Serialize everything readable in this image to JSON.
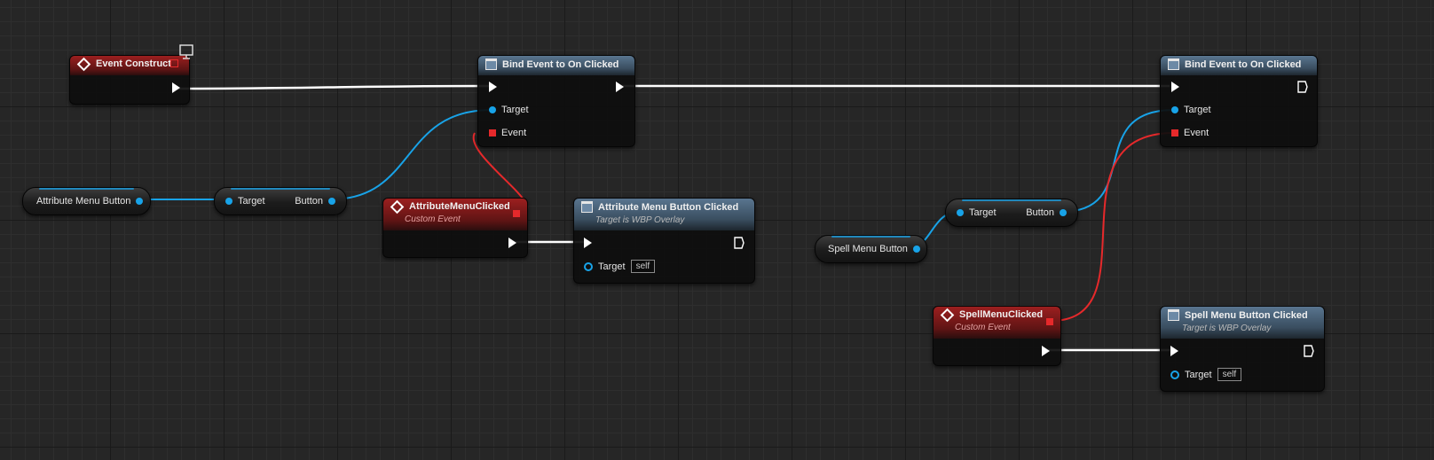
{
  "nodes": {
    "event_construct": {
      "title": "Event Construct"
    },
    "bind1": {
      "title": "Bind Event to On Clicked",
      "target": "Target",
      "event": "Event"
    },
    "bind2": {
      "title": "Bind Event to On Clicked",
      "target": "Target",
      "event": "Event"
    },
    "attr_var": {
      "label": "Attribute Menu Button"
    },
    "attr_get": {
      "target": "Target",
      "button": "Button"
    },
    "attr_event": {
      "title": "AttributeMenuClicked",
      "subtitle": "Custom Event"
    },
    "attr_call": {
      "title": "Attribute Menu Button Clicked",
      "subtitle": "Target is WBP Overlay",
      "target": "Target",
      "self": "self"
    },
    "spell_var": {
      "label": "Spell Menu Button"
    },
    "spell_get": {
      "target": "Target",
      "button": "Button"
    },
    "spell_event": {
      "title": "SpellMenuClicked",
      "subtitle": "Custom Event"
    },
    "spell_call": {
      "title": "Spell Menu Button Clicked",
      "subtitle": "Target is WBP Overlay",
      "target": "Target",
      "self": "self"
    }
  },
  "colors": {
    "exec": "#ffffff",
    "object": "#18a3e8",
    "delegate": "#e6292b",
    "event_header": "#9c1f1f",
    "function_header": "#59758f"
  },
  "icons": [
    "event-diamond-icon",
    "function-icon",
    "monitor-icon",
    "exec-pin-icon",
    "object-pin-icon",
    "delegate-pin-icon"
  ]
}
